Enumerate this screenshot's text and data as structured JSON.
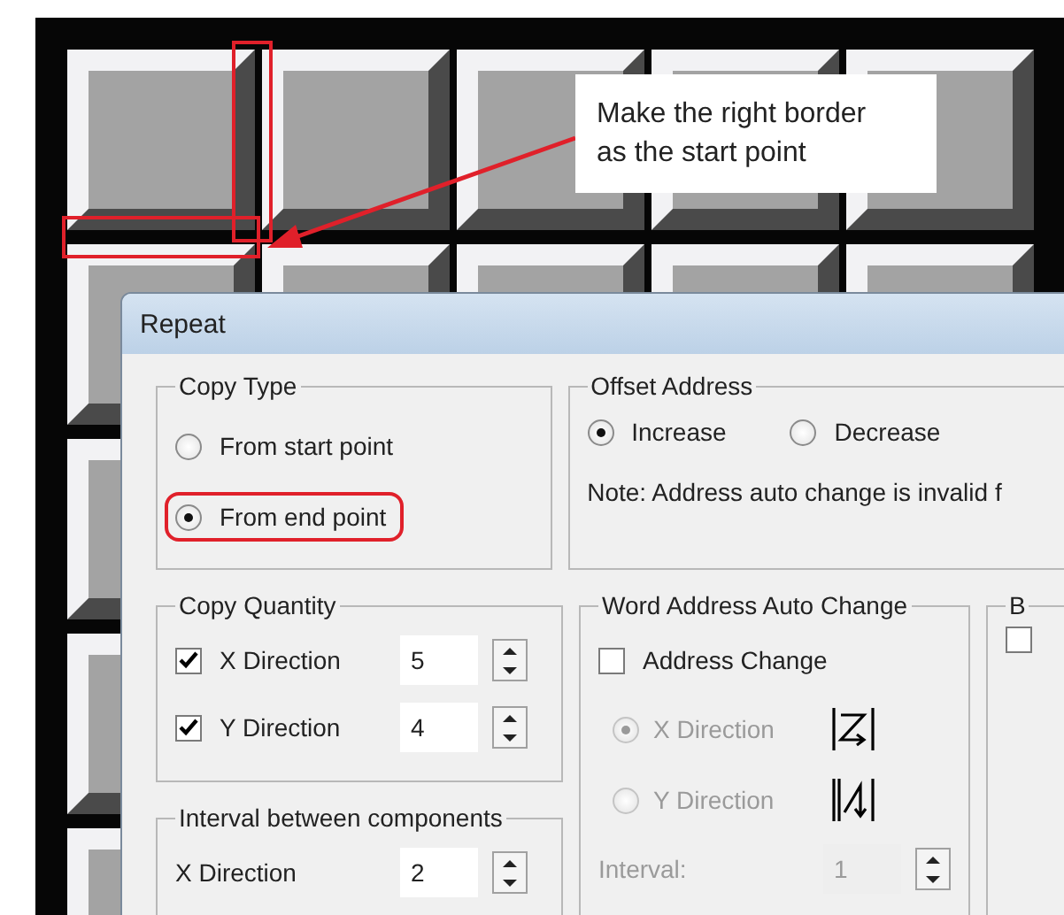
{
  "annotation": {
    "callout": "Make the right border\nas the start point"
  },
  "dialog": {
    "title": "Repeat",
    "copy_type": {
      "title": "Copy Type",
      "options": [
        {
          "label": "From start point",
          "selected": false,
          "highlighted": false
        },
        {
          "label": "From end point",
          "selected": true,
          "highlighted": true
        }
      ]
    },
    "offset_address": {
      "title": "Offset Address",
      "options": [
        {
          "label": "Increase",
          "selected": true
        },
        {
          "label": "Decrease",
          "selected": false
        }
      ],
      "note": "Note: Address auto change is invalid f"
    },
    "copy_quantity": {
      "title": "Copy Quantity",
      "rows": [
        {
          "label": "X Direction",
          "checked": true,
          "value": "5"
        },
        {
          "label": "Y Direction",
          "checked": true,
          "value": "4"
        }
      ]
    },
    "interval": {
      "title": "Interval between components",
      "rows": [
        {
          "label": "X Direction",
          "value": "2"
        }
      ]
    },
    "word_address": {
      "title": "Word Address Auto Change",
      "checkbox": {
        "label": "Address Change",
        "checked": false
      },
      "directions": [
        {
          "label": "X Direction",
          "selected": true,
          "disabled": true,
          "kind": "z"
        },
        {
          "label": "Y Direction",
          "selected": false,
          "disabled": true,
          "kind": "n"
        }
      ],
      "interval_label": "Interval:",
      "interval_value": "1",
      "interval_disabled": true
    },
    "group_3": {
      "title": "B",
      "checkbox": {
        "checked": false
      }
    }
  }
}
